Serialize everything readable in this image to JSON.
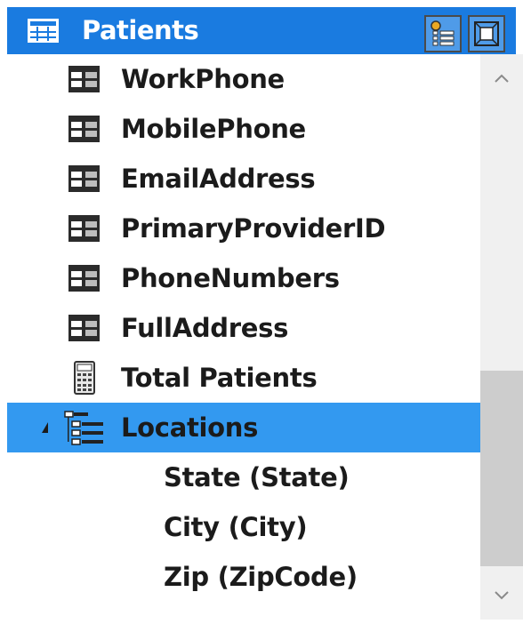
{
  "header": {
    "title": "Patients",
    "table_icon": "table-icon",
    "buttons": [
      {
        "name": "hierarchy-view-button",
        "icon": "hierarchy-icon"
      },
      {
        "name": "fit-to-view-button",
        "icon": "fit-to-view-icon"
      }
    ]
  },
  "fields": [
    {
      "label": "WorkPhone",
      "icon": "column-icon"
    },
    {
      "label": "MobilePhone",
      "icon": "column-icon"
    },
    {
      "label": "EmailAddress",
      "icon": "column-icon"
    },
    {
      "label": "PrimaryProviderID",
      "icon": "column-icon"
    },
    {
      "label": "PhoneNumbers",
      "icon": "column-icon"
    },
    {
      "label": "FullAddress",
      "icon": "column-icon"
    },
    {
      "label": "Total Patients",
      "icon": "measure-calculator-icon"
    }
  ],
  "hierarchy": {
    "label": "Locations",
    "icon": "hierarchy-icon",
    "expanded": true,
    "selected": true,
    "levels": [
      {
        "label": "State (State)"
      },
      {
        "label": "City (City)"
      },
      {
        "label": "Zip (ZipCode)"
      }
    ]
  },
  "colors": {
    "header_bg": "#1a7be0",
    "selected_bg": "#3399f0",
    "text": "#1b1b1b",
    "scroll_track": "#f0f0f0",
    "scroll_thumb": "#cdcdcd"
  },
  "scrollbar": {
    "up_icon": "chevron-up-icon",
    "down_icon": "chevron-down-icon"
  }
}
